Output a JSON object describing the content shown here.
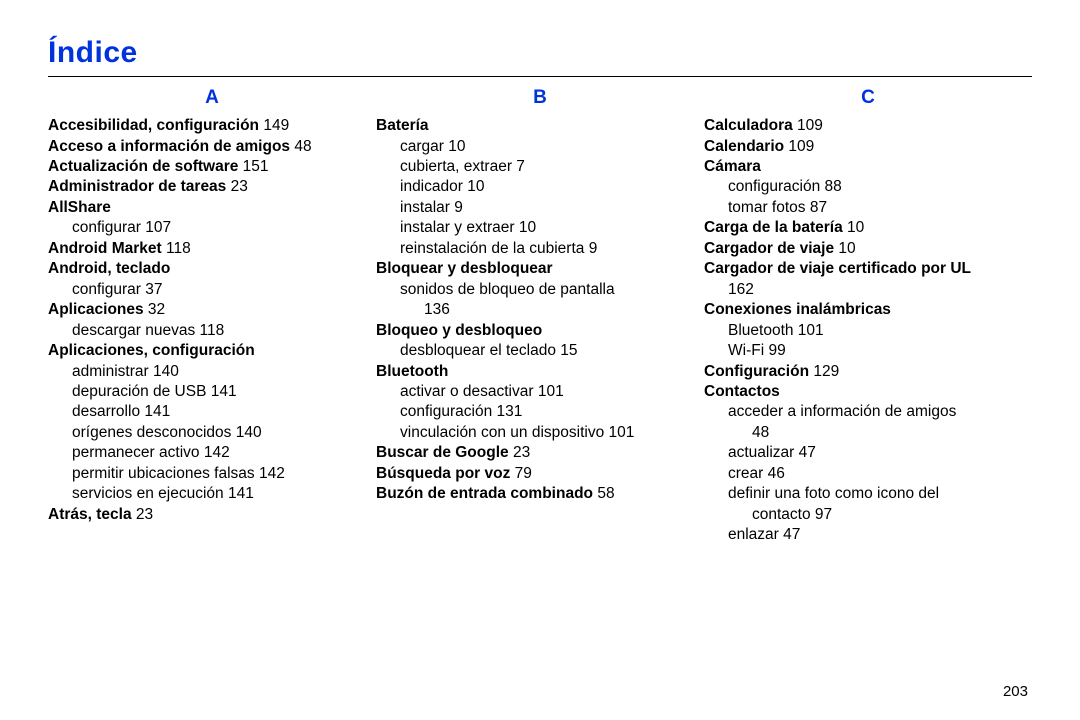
{
  "title": "Índice",
  "page_number": "203",
  "columns": [
    {
      "letter": "A",
      "entries": [
        {
          "t": "l1",
          "term": "Accesibilidad, configuración",
          "pg": "149"
        },
        {
          "t": "l1",
          "term": "Acceso a información de amigos",
          "pg": "48"
        },
        {
          "t": "l1",
          "term": "Actualización de software",
          "pg": "151"
        },
        {
          "t": "l1",
          "term": "Administrador de tareas",
          "pg": "23"
        },
        {
          "t": "l1",
          "term": "AllShare"
        },
        {
          "t": "l2",
          "text": "configurar",
          "pg": "107"
        },
        {
          "t": "l1",
          "term": "Android Market",
          "pg": "118"
        },
        {
          "t": "l1",
          "term": "Android, teclado"
        },
        {
          "t": "l2",
          "text": "configurar",
          "pg": "37"
        },
        {
          "t": "l1",
          "term": "Aplicaciones",
          "pg": "32"
        },
        {
          "t": "l2",
          "text": "descargar nuevas",
          "pg": "118"
        },
        {
          "t": "l1",
          "term": "Aplicaciones, configuración"
        },
        {
          "t": "l2",
          "text": "administrar",
          "pg": "140"
        },
        {
          "t": "l2",
          "text": "depuración de USB",
          "pg": "141"
        },
        {
          "t": "l2",
          "text": "desarrollo",
          "pg": "141"
        },
        {
          "t": "l2",
          "text": "orígenes desconocidos",
          "pg": "140"
        },
        {
          "t": "l2",
          "text": "permanecer activo",
          "pg": "142"
        },
        {
          "t": "l2",
          "text": "permitir ubicaciones falsas",
          "pg": "142"
        },
        {
          "t": "l2",
          "text": "servicios en ejecución",
          "pg": "141"
        },
        {
          "t": "l1",
          "term": "Atrás, tecla",
          "pg": "23"
        }
      ]
    },
    {
      "letter": "B",
      "entries": [
        {
          "t": "l1",
          "term": "Batería"
        },
        {
          "t": "l2",
          "text": "cargar",
          "pg": "10"
        },
        {
          "t": "l2",
          "text": "cubierta, extraer",
          "pg": "7"
        },
        {
          "t": "l2",
          "text": "indicador",
          "pg": "10"
        },
        {
          "t": "l2",
          "text": "instalar",
          "pg": "9"
        },
        {
          "t": "l2",
          "text": "instalar y extraer",
          "pg": "10"
        },
        {
          "t": "l2",
          "text": "reinstalación de la cubierta",
          "pg": "9"
        },
        {
          "t": "l1",
          "term": "Bloquear y desbloquear"
        },
        {
          "t": "l2",
          "text": "sonidos de bloqueo de pantalla"
        },
        {
          "t": "l3",
          "text": "",
          "pg": "136"
        },
        {
          "t": "l1",
          "term": "Bloqueo y desbloqueo"
        },
        {
          "t": "l2",
          "text": "desbloquear el teclado",
          "pg": "15"
        },
        {
          "t": "l1",
          "term": "Bluetooth"
        },
        {
          "t": "l2",
          "text": "activar o desactivar",
          "pg": "101"
        },
        {
          "t": "l2",
          "text": "configuración",
          "pg": "131"
        },
        {
          "t": "l2",
          "text": "vinculación con un dispositivo",
          "pg": "101"
        },
        {
          "t": "l1",
          "term": "Buscar de Google",
          "pg": "23"
        },
        {
          "t": "l1",
          "term": "Búsqueda por voz",
          "pg": "79"
        },
        {
          "t": "l1",
          "term": "Buzón de entrada combinado",
          "pg": "58"
        }
      ]
    },
    {
      "letter": "C",
      "entries": [
        {
          "t": "l1",
          "term": "Calculadora",
          "pg": "109"
        },
        {
          "t": "l1",
          "term": "Calendario",
          "pg": "109"
        },
        {
          "t": "l1",
          "term": "Cámara"
        },
        {
          "t": "l2",
          "text": "configuración",
          "pg": "88"
        },
        {
          "t": "l2",
          "text": "tomar fotos",
          "pg": "87"
        },
        {
          "t": "l1",
          "term": "Carga de la batería",
          "pg": "10"
        },
        {
          "t": "l1",
          "term": "Cargador de viaje",
          "pg": "10"
        },
        {
          "t": "l1",
          "term": "Cargador de viaje certificado por UL"
        },
        {
          "t": "l2",
          "text": "",
          "pg": "162"
        },
        {
          "t": "l1",
          "term": "Conexiones inalámbricas"
        },
        {
          "t": "l2",
          "text": "Bluetooth",
          "pg": "101"
        },
        {
          "t": "l2",
          "text": "Wi-Fi",
          "pg": "99"
        },
        {
          "t": "l1",
          "term": "Configuración",
          "pg": "129"
        },
        {
          "t": "l1",
          "term": "Contactos"
        },
        {
          "t": "l2",
          "text": "acceder a información de amigos"
        },
        {
          "t": "l3",
          "text": "",
          "pg": "48"
        },
        {
          "t": "l2",
          "text": "actualizar",
          "pg": "47"
        },
        {
          "t": "l2",
          "text": "crear",
          "pg": "46"
        },
        {
          "t": "l2",
          "text": "definir una foto como icono del"
        },
        {
          "t": "l3",
          "text": "contacto",
          "pg": "97"
        },
        {
          "t": "l2",
          "text": "enlazar",
          "pg": "47"
        }
      ]
    }
  ]
}
